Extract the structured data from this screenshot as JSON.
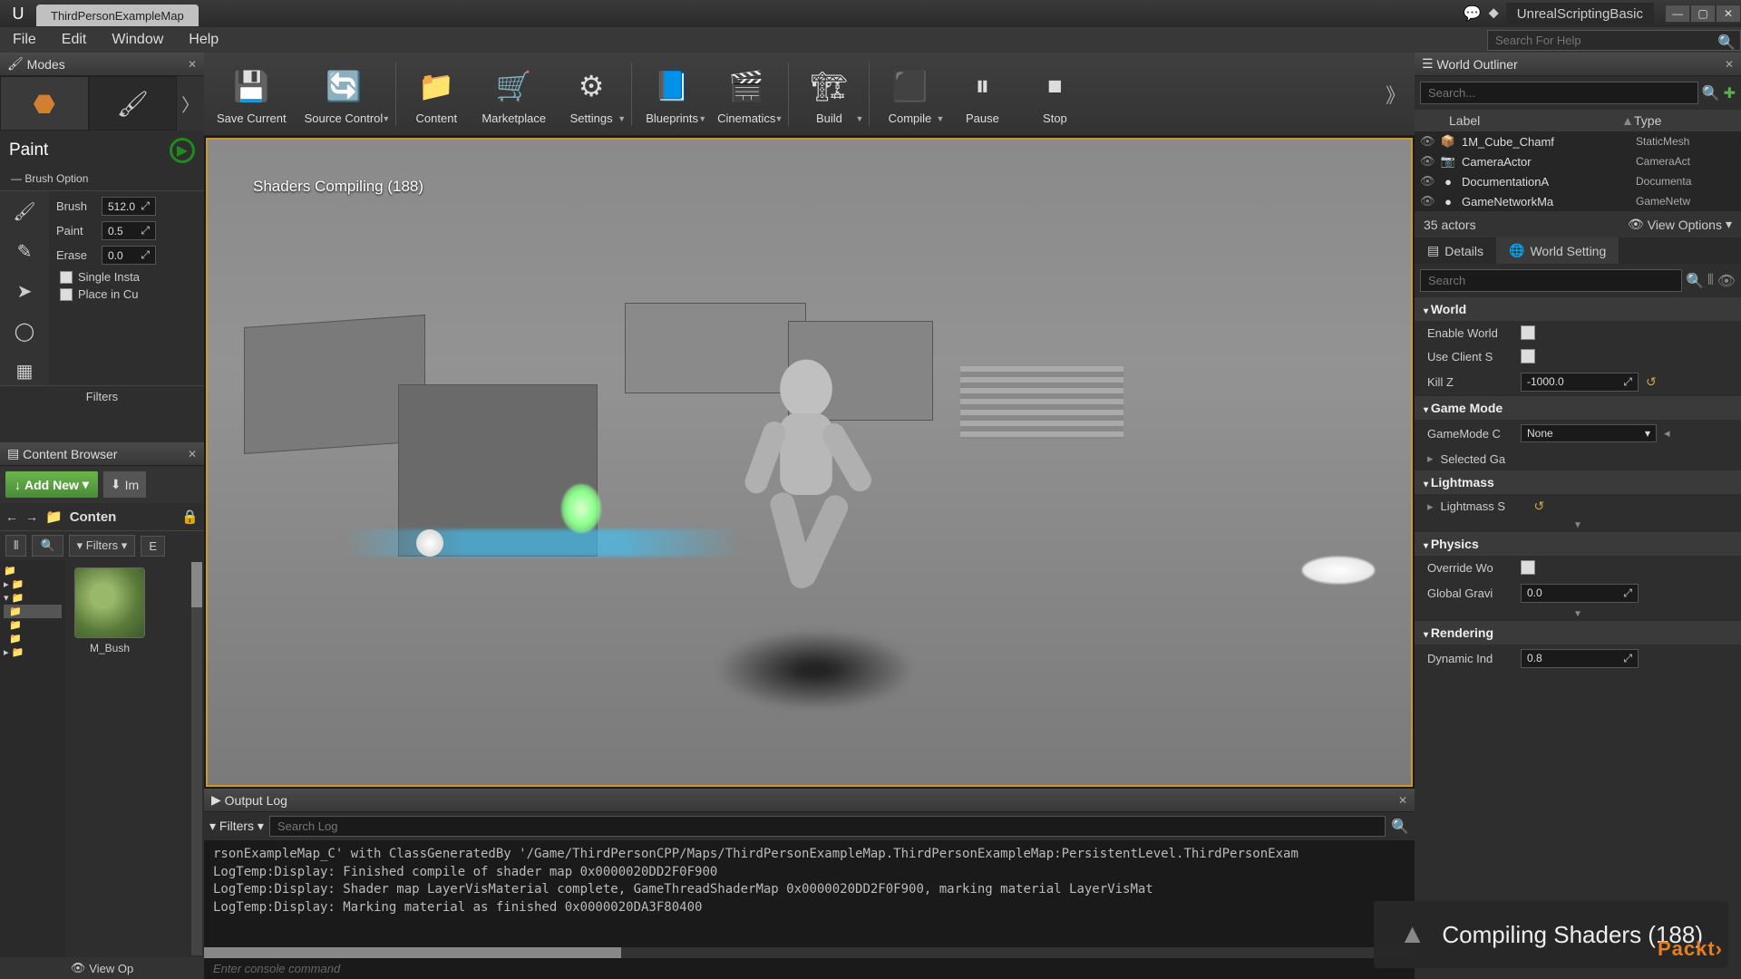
{
  "title": {
    "tab": "ThirdPersonExampleMap",
    "project": "UnrealScriptingBasic"
  },
  "menu": [
    "File",
    "Edit",
    "Window",
    "Help"
  ],
  "search_help_placeholder": "Search For Help",
  "toolbar": [
    {
      "label": "Save Current",
      "icon": "💾",
      "dd": false
    },
    {
      "label": "Source Control",
      "icon": "🔄",
      "dd": true
    },
    {
      "sep": true
    },
    {
      "label": "Content",
      "icon": "📁",
      "dd": false
    },
    {
      "label": "Marketplace",
      "icon": "🛒",
      "dd": false
    },
    {
      "label": "Settings",
      "icon": "⚙",
      "dd": true
    },
    {
      "sep": true
    },
    {
      "label": "Blueprints",
      "icon": "📘",
      "dd": true
    },
    {
      "label": "Cinematics",
      "icon": "🎬",
      "dd": true
    },
    {
      "sep": true
    },
    {
      "label": "Build",
      "icon": "🏗",
      "dd": true
    },
    {
      "sep": true
    },
    {
      "label": "Compile",
      "icon": "⬛",
      "dd": true
    },
    {
      "label": "Pause",
      "icon": "⏸",
      "dd": false
    },
    {
      "label": "Stop",
      "icon": "⏹",
      "dd": false
    }
  ],
  "modes": {
    "title": "Modes",
    "paint_title": "Paint",
    "brush_option_label": "—  Brush Option",
    "props": [
      {
        "label": "Brush",
        "value": "512.0"
      },
      {
        "label": "Paint",
        "value": "0.5"
      },
      {
        "label": "Erase",
        "value": "0.0"
      }
    ],
    "checks": [
      "Single Insta",
      "Place in Cu"
    ],
    "filters_label": "Filters"
  },
  "content_browser": {
    "title": "Content Browser",
    "add_new": "Add New",
    "import": "Im",
    "path": "Conten",
    "filters_label": "Filters",
    "asset": {
      "name": "M_Bush"
    },
    "view_options": "View Op"
  },
  "viewport": {
    "shader_text": "Shaders Compiling (188)"
  },
  "outliner": {
    "title": "World Outliner",
    "search_placeholder": "Search...",
    "col_label": "Label",
    "col_type": "Type",
    "rows": [
      {
        "icon": "📦",
        "name": "1M_Cube_Chamf",
        "type": "StaticMesh"
      },
      {
        "icon": "📷",
        "name": "CameraActor",
        "type": "CameraAct"
      },
      {
        "icon": "●",
        "name": "DocumentationA",
        "type": "Documenta"
      },
      {
        "icon": "●",
        "name": "GameNetworkMa",
        "type": "GameNetw"
      }
    ],
    "count": "35 actors",
    "view_options": "View Options"
  },
  "details": {
    "tab1": "Details",
    "tab2": "World Setting",
    "search_placeholder": "Search",
    "cats": {
      "world": {
        "title": "World",
        "enable": "Enable World",
        "client": "Use Client S",
        "killz_label": "Kill Z",
        "killz": "-1000.0"
      },
      "gamemode": {
        "title": "Game Mode",
        "label": "GameMode C",
        "value": "None",
        "selected": "Selected Ga"
      },
      "lightmass": {
        "title": "Lightmass",
        "label": "Lightmass S"
      },
      "physics": {
        "title": "Physics",
        "override": "Override Wo",
        "gravity_label": "Global Gravi",
        "gravity": "0.0"
      },
      "rendering": {
        "title": "Rendering",
        "dyn_label": "Dynamic Ind",
        "dyn": "0.8"
      }
    }
  },
  "log": {
    "title": "Output Log",
    "filters": "Filters",
    "search_placeholder": "Search Log",
    "lines": [
      "rsonExampleMap_C' with ClassGeneratedBy '/Game/ThirdPersonCPP/Maps/ThirdPersonExampleMap.ThirdPersonExampleMap:PersistentLevel.ThirdPersonExam",
      "LogTemp:Display: Finished compile of shader map 0x0000020DD2F0F900",
      "LogTemp:Display: Shader map LayerVisMaterial complete, GameThreadShaderMap 0x0000020DD2F0F900, marking material LayerVisMat",
      "LogTemp:Display: Marking material as finished 0x0000020DA3F80400"
    ],
    "cmd_placeholder": "Enter console command"
  },
  "toast": "Compiling Shaders (188)",
  "packt": "Packt›"
}
